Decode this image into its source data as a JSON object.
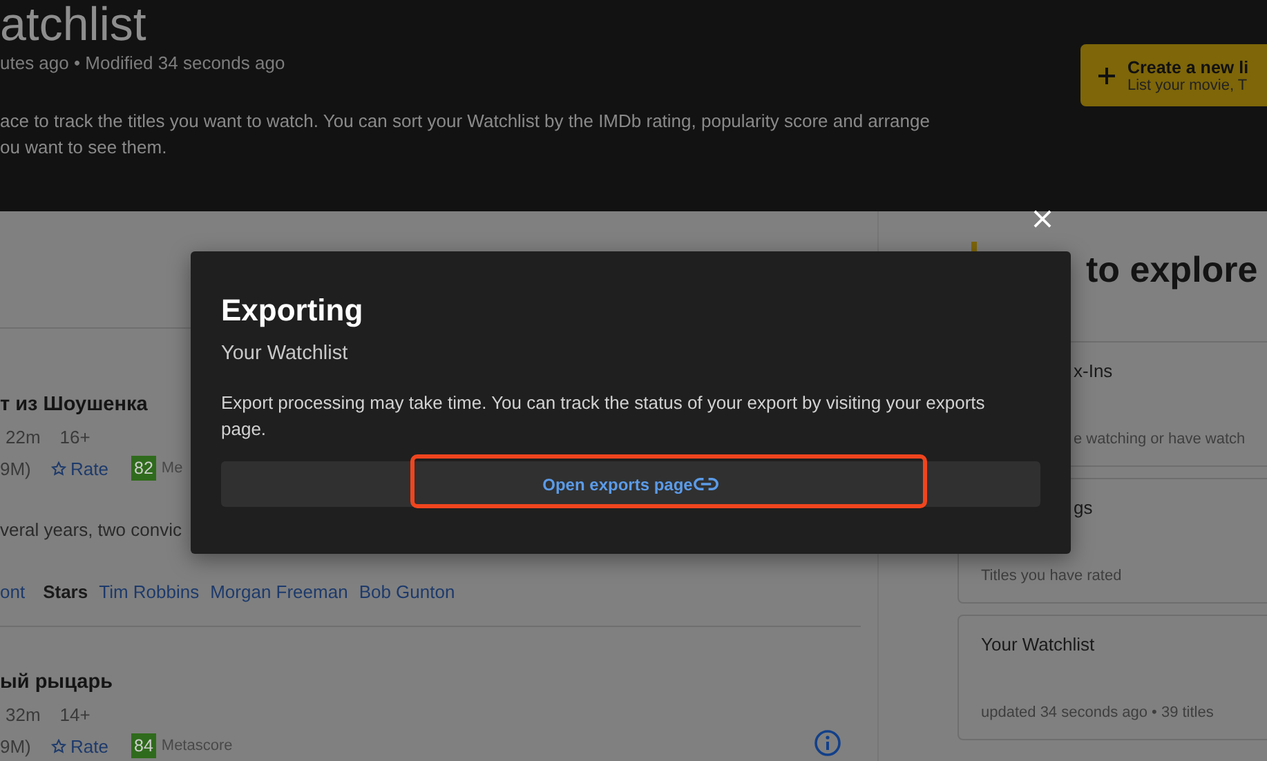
{
  "header": {
    "title": "atchlist",
    "meta": "utes ago • Modified 34 seconds ago",
    "description_lines": [
      "ace to track the titles you want to watch. You can sort your Watchlist by the IMDb rating, popularity score and arrange",
      "ou want to see them."
    ],
    "create_button": {
      "label": "Create a new li",
      "sublabel": "List your movie, T"
    }
  },
  "titles": [
    {
      "title": "т из Шоушенка",
      "runtime": "22m",
      "rating": "16+",
      "votes": "9M)",
      "rate": "Rate",
      "metascore": "82",
      "metascore_label": "Me",
      "description": "veral years, two convic",
      "credits": [
        {
          "text": "ont",
          "kind": "link"
        },
        {
          "text": "Stars",
          "kind": "label"
        },
        {
          "text": "Tim Robbins",
          "kind": "link"
        },
        {
          "text": "Morgan Freeman",
          "kind": "link"
        },
        {
          "text": "Bob Gunton",
          "kind": "link"
        }
      ]
    },
    {
      "title": "ый рыцарь",
      "runtime": "32m",
      "rating": "14+",
      "votes": "9M)",
      "rate": "Rate",
      "metascore": "84",
      "metascore_label": "Metascore",
      "info": true
    }
  ],
  "sidebar": {
    "heading": "to explore",
    "cards": [
      {
        "title": "x-Ins",
        "subtitle": "e watching or have watch"
      },
      {
        "title": "gs",
        "subtitle": "Titles you have rated"
      },
      {
        "title": "Your Watchlist",
        "subtitle": "updated 34 seconds ago • 39 titles"
      }
    ]
  },
  "dialog": {
    "title": "Exporting",
    "subtitle": "Your Watchlist",
    "body": "Export processing may take time. You can track the status of your export by visiting your exports page.",
    "button": "Open exports page",
    "highlighted": true
  }
}
